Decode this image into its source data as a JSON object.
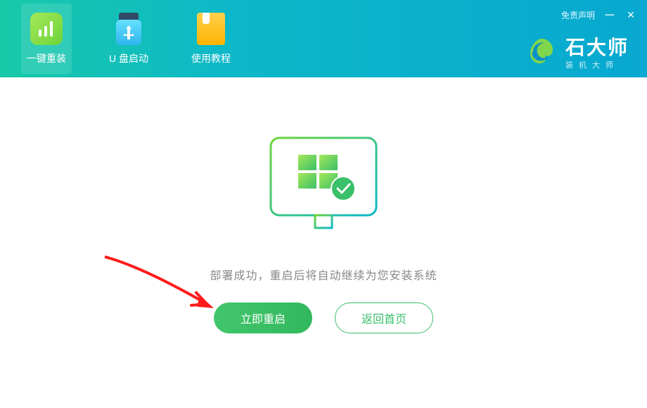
{
  "header": {
    "tabs": [
      {
        "label": "一键重装"
      },
      {
        "label": "U 盘启动"
      },
      {
        "label": "使用教程"
      }
    ],
    "disclaimer": "免责声明",
    "brand_title": "石大师",
    "brand_sub": "装机大师"
  },
  "main": {
    "status_text": "部署成功，重启后将自动继续为您安装系统",
    "primary_button": "立即重启",
    "secondary_button": "返回首页"
  }
}
